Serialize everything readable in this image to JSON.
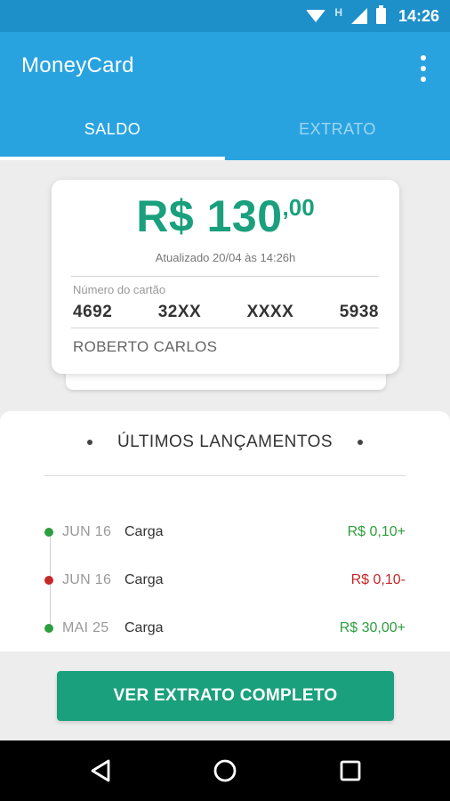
{
  "status_bar": {
    "time": "14:26",
    "network_letter": "H",
    "icons": [
      "wifi-icon",
      "signal-icon",
      "battery-icon"
    ]
  },
  "app": {
    "title": "MoneyCard",
    "menu_icon": "more-vert-icon"
  },
  "tabs": [
    {
      "label": "SALDO",
      "active": true
    },
    {
      "label": "EXTRATO",
      "active": false
    }
  ],
  "balance_card": {
    "amount_main": "R$ 130",
    "amount_cents": ",00",
    "updated_text": "Atualizado 20/04 às 14:26h",
    "card_number_label": "Número do cartão",
    "card_number_groups": [
      "4692",
      "32XX",
      "XXXX",
      "5938"
    ],
    "holder_name": "ROBERTO CARLOS"
  },
  "recent": {
    "title": "ÚLTIMOS LANÇAMENTOS",
    "transactions": [
      {
        "date": "JUN 16",
        "description": "Carga",
        "amount": "R$ 0,10+",
        "type": "credit"
      },
      {
        "date": "JUN 16",
        "description": "Carga",
        "amount": "R$ 0,10-",
        "type": "debit"
      },
      {
        "date": "MAI 25",
        "description": "Carga",
        "amount": "R$ 30,00+",
        "type": "credit"
      }
    ]
  },
  "cta": {
    "label": "VER EXTRATO COMPLETO"
  },
  "nav": {
    "back_icon": "back-icon",
    "home_icon": "home-icon",
    "recents_icon": "recents-icon"
  },
  "colors": {
    "primary": "#29a3e0",
    "status_bar": "#1d8fc9",
    "accent_green": "#1aa07c",
    "credit": "#2e9e3e",
    "debit": "#c62828"
  }
}
